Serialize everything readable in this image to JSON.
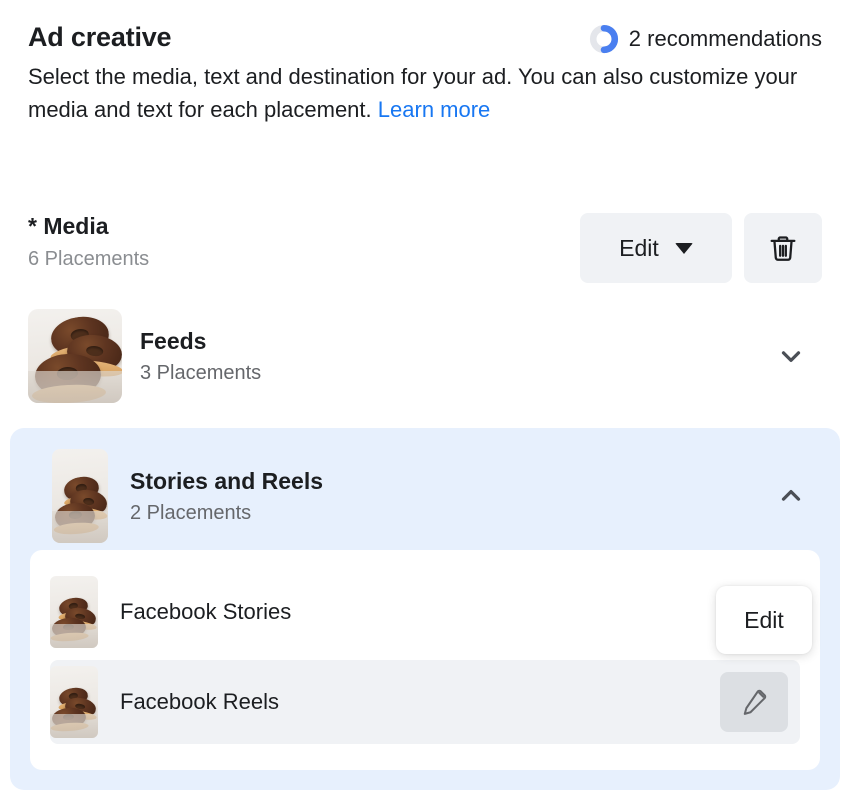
{
  "header": {
    "title": "Ad creative",
    "recommendations_icon": "progress-ring-icon",
    "recommendations_label": "2 recommendations",
    "description": "Select the media, text and destination for your ad. You can also customize your media and text for each placement.",
    "learn_more_label": "Learn more"
  },
  "media": {
    "title": "* Media",
    "subtitle": "6 Placements",
    "edit_button_label": "Edit",
    "edit_caret_icon": "chevron-down-icon",
    "delete_icon": "trash-icon"
  },
  "groups": [
    {
      "id": "feeds",
      "title": "Feeds",
      "subtitle": "3 Placements",
      "expanded": false,
      "chevron_icon": "chevron-down-icon",
      "thumbnail": "donuts-thumbnail"
    },
    {
      "id": "stories-and-reels",
      "title": "Stories and Reels",
      "subtitle": "2 Placements",
      "expanded": true,
      "chevron_icon": "chevron-up-icon",
      "thumbnail": "donuts-thumbnail",
      "placements": [
        {
          "id": "facebook-stories",
          "label": "Facebook Stories",
          "thumbnail": "donuts-thumbnail",
          "action_label": "Edit",
          "action_type": "text-button"
        },
        {
          "id": "facebook-reels",
          "label": "Facebook Reels",
          "thumbnail": "donuts-thumbnail",
          "action_icon": "pencil-icon",
          "action_type": "icon-button"
        }
      ]
    }
  ],
  "colors": {
    "link": "#1877f2",
    "highlight_panel": "#e7f0fd",
    "button_surface": "#f0f2f5",
    "text_primary": "#1c1e21",
    "text_secondary": "#65676b",
    "text_muted": "#8a8d91"
  }
}
